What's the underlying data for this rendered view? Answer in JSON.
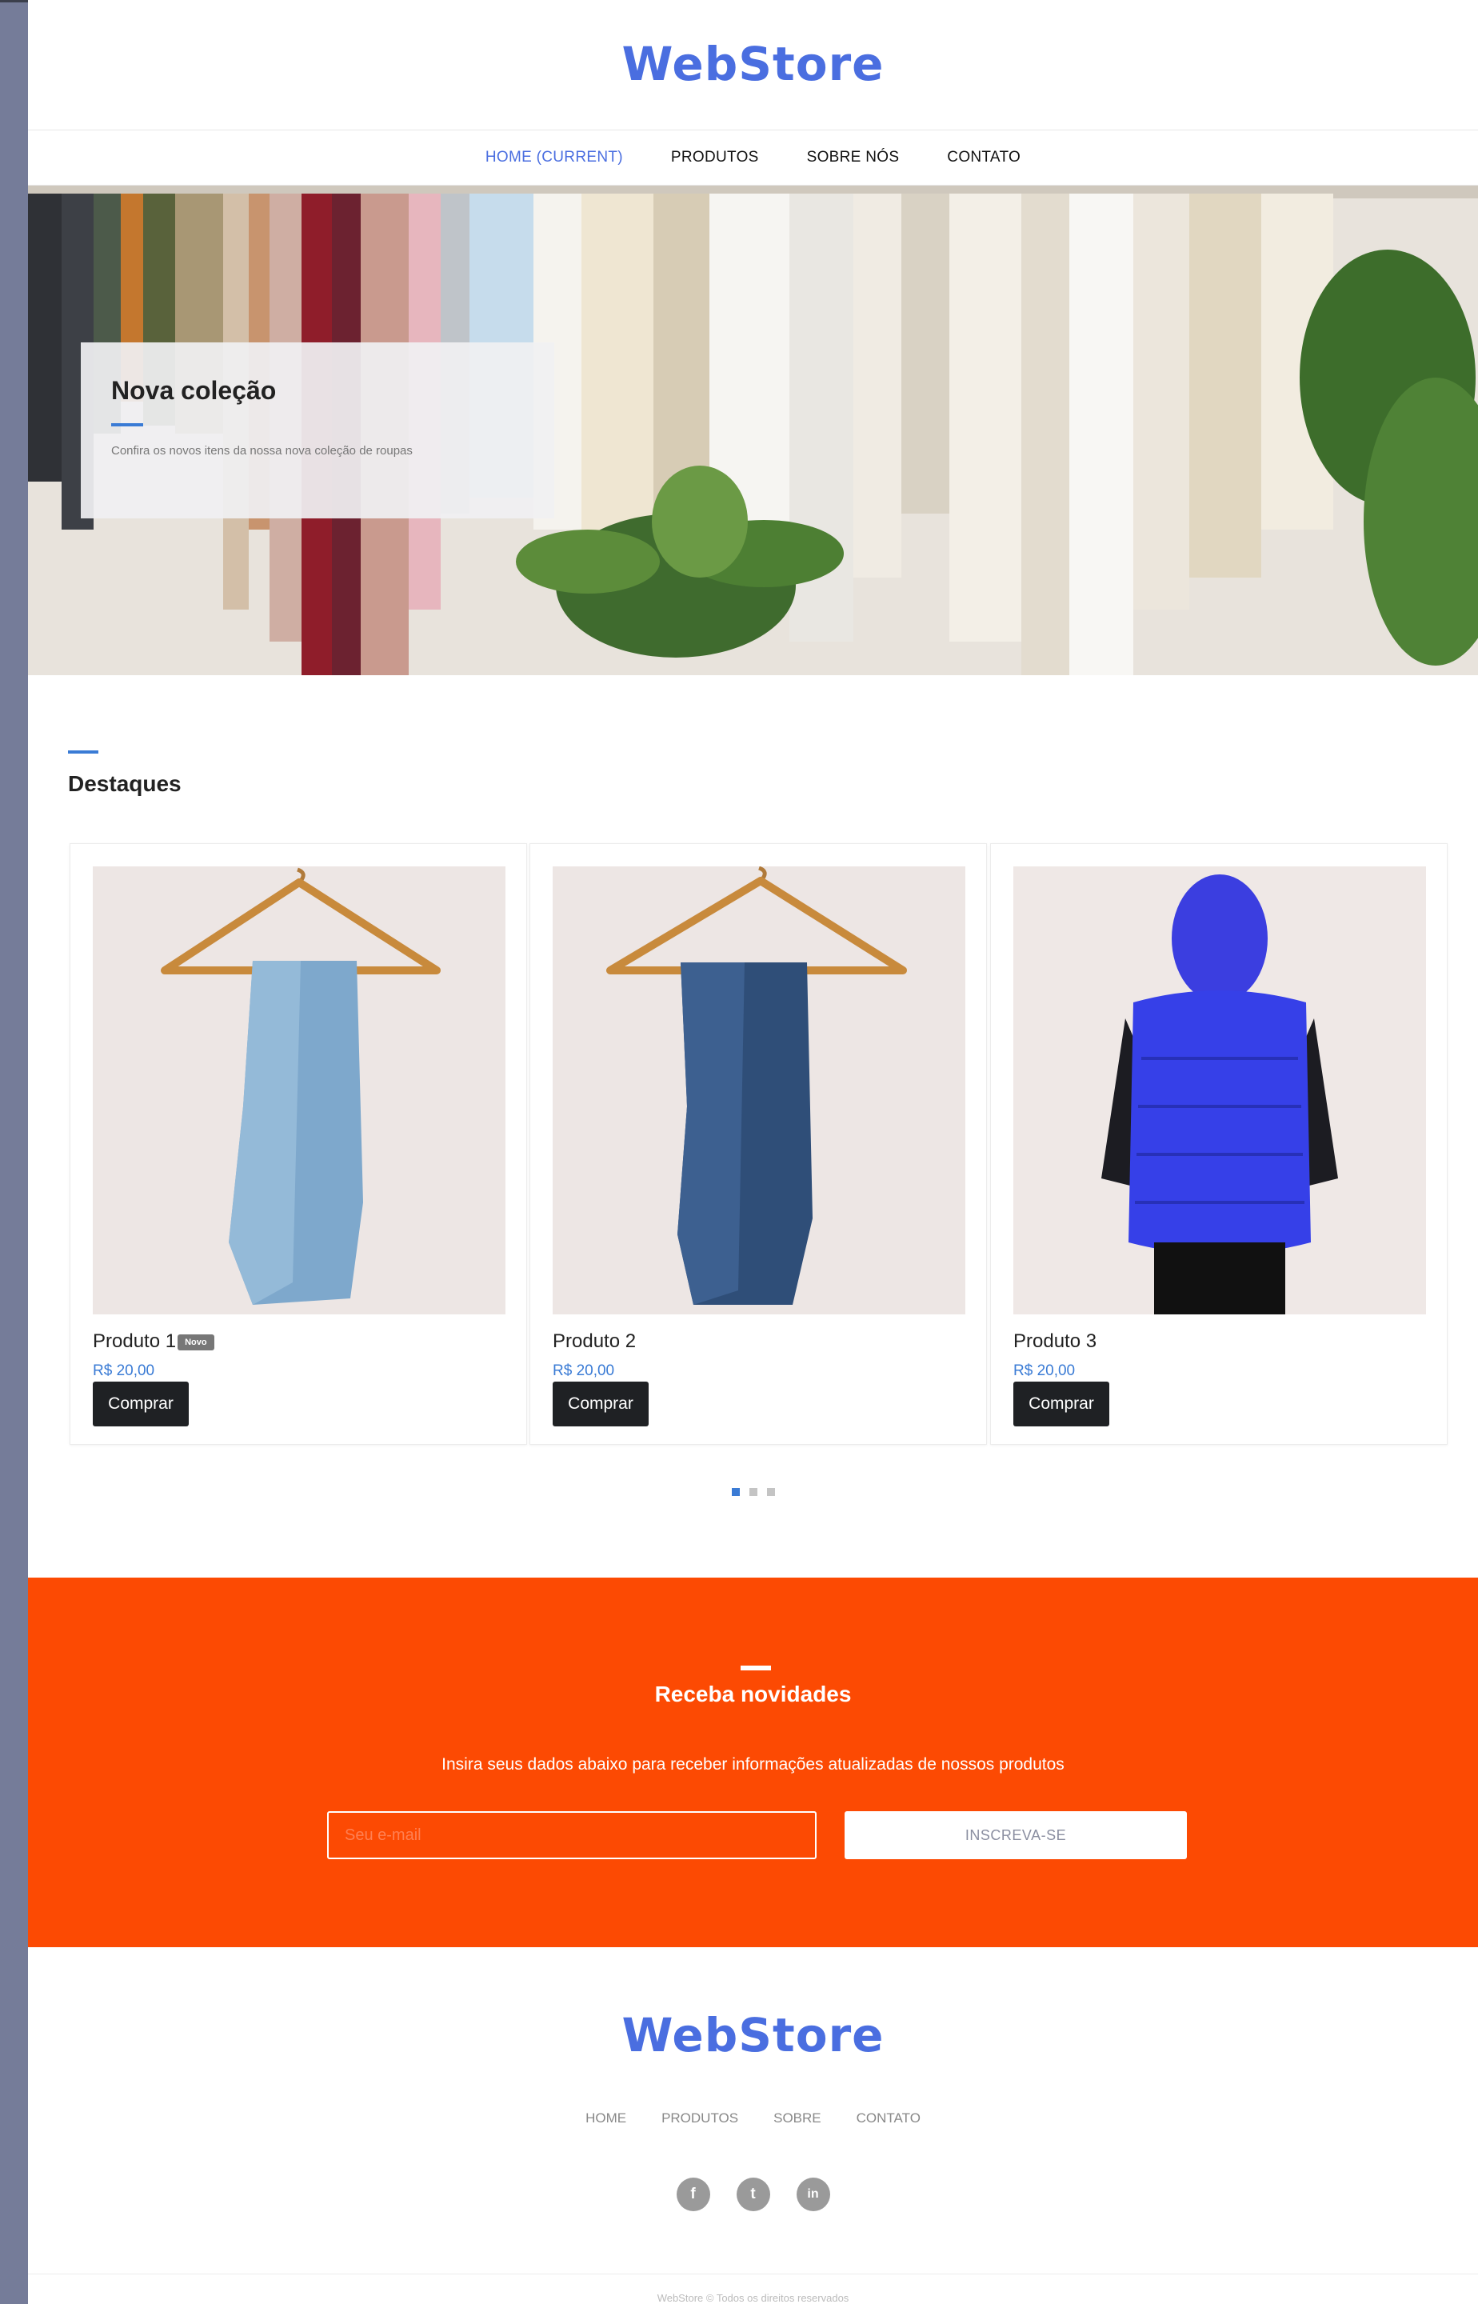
{
  "header": {
    "brand": "WebStore"
  },
  "nav": {
    "items": [
      {
        "label": "HOME (CURRENT)",
        "current": true
      },
      {
        "label": "PRODUTOS"
      },
      {
        "label": "SOBRE NÓS"
      },
      {
        "label": "CONTATO"
      }
    ]
  },
  "hero": {
    "title": "Nova coleção",
    "text": "Confira os novos itens da nossa nova coleção de roupas"
  },
  "featured": {
    "title": "Destaques",
    "products": [
      {
        "name": "Produto 1",
        "badge": "Novo",
        "price": "R$ 20,00",
        "button": "Comprar"
      },
      {
        "name": "Produto 2",
        "price": "R$ 20,00",
        "button": "Comprar"
      },
      {
        "name": "Produto 3",
        "price": "R$ 20,00",
        "button": "Comprar"
      }
    ],
    "carousel": {
      "pages": 3,
      "active": 1
    }
  },
  "newsletter": {
    "title": "Receba novidades",
    "text": "Insira seus dados abaixo para receber informações atualizadas de nossos produtos",
    "placeholder": "Seu e-mail",
    "button": "INSCREVA-SE"
  },
  "footer": {
    "brand": "WebStore",
    "nav": [
      "HOME",
      "PRODUTOS",
      "SOBRE",
      "CONTATO"
    ],
    "social": [
      {
        "icon": "facebook-icon",
        "glyph": "f"
      },
      {
        "icon": "twitter-icon",
        "glyph": "t"
      },
      {
        "icon": "linkedin-icon",
        "glyph": "in"
      }
    ],
    "copyright": "WebStore © Todos os direitos reservados"
  },
  "colors": {
    "brand": "#4a6ee0",
    "accent": "#3a7bd5",
    "newsletter_bg": "#fc4a03",
    "button_dark": "#1f2124"
  }
}
